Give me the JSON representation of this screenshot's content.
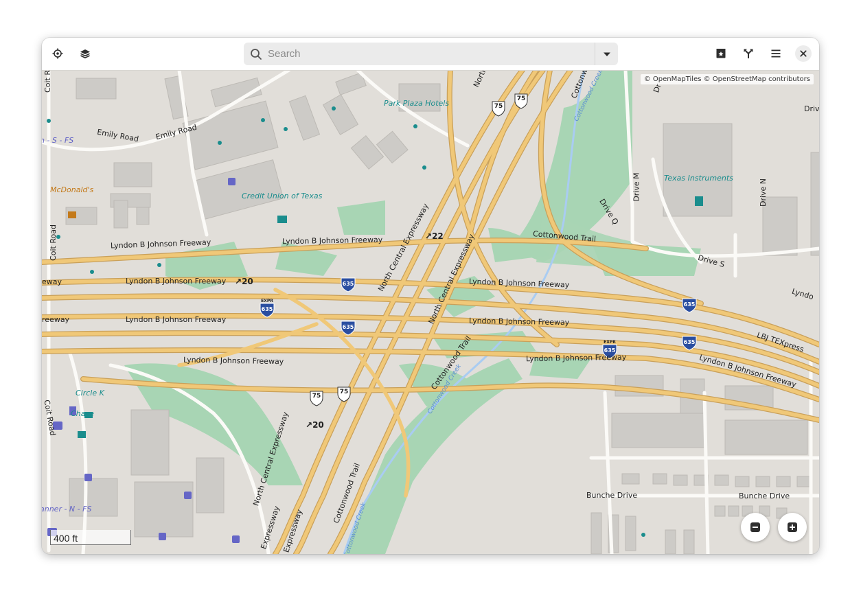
{
  "header": {
    "search_placeholder": "Search",
    "search_value": ""
  },
  "map": {
    "attribution": "© OpenMapTiles © OpenStreetMap contributors",
    "scale_label": "400 ft",
    "labels": {
      "emily_road_1": "Emily Road",
      "emily_road_2": "Emily Road",
      "coit_road_1": "Coit Road",
      "coit_road_2": "Coit Road",
      "coit_road_3": "Coit R",
      "bus_s": "n - S - FS",
      "bus_n": "anner - N - FS",
      "mcdonalds": "McDonald's",
      "credit_union": "Credit Union of Texas",
      "park_plaza": "Park Plaza Hotels",
      "texas_instruments": "Texas Instruments",
      "circle_k": "Circle K",
      "chase": "Chase",
      "lbj_1": "Lyndon B Johnson Freeway",
      "lbj_2": "Lyndon B Johnson Freeway",
      "lbj_3": "Lyndon B Johnson Freeway",
      "lbj_4": "Lyndon B Johnson Freeway",
      "lbj_5": "Lyndon B Johnson Freeway",
      "lbj_6": "Lyndon B Johnson Freeway",
      "lbj_7": "Lyndon B Johnson Freeway",
      "lbj_8": "Lyndon B Johnson Freeway",
      "lbj_9": "Lyndon B Johnson Freeway",
      "lbj_10": "Lyndon B Johnson Freeway",
      "lbj_edge_1": "eway",
      "lbj_edge_2": "reeway",
      "lbj_edge_3": "Lyndo",
      "lbj_texpress": "LBJ TEXpress",
      "nce_1": "North Central Expressway",
      "nce_2": "North Central Expressway",
      "nce_3": "North Central Expressway",
      "nce_4": "Expressway",
      "nce_5": "Expressway",
      "nce_6": "North",
      "cottonwood_trail_1": "Cottonwood Trail",
      "cottonwood_trail_2": "Cottonwood Trail",
      "cottonwood_trail_3": "Cottonwood Trail",
      "cottonwood_trail_4": "Cottonwo",
      "cottonwood_creek_1": "Cottonwood Creek",
      "cottonwood_creek_2": "Cottonwood Creek",
      "cottonwood_creek_3": "Cottonwood Creek",
      "drive_m": "Drive M",
      "drive_n": "Drive N",
      "drive_q": "Drive Q",
      "drive_s": "Drive S",
      "drive_top": "Driv",
      "drive_top2": "Dr",
      "bunche_1": "Bunche Drive",
      "bunche_2": "Bunche Drive",
      "exit_22": "22",
      "exit_20a": "20",
      "exit_20b": "20",
      "shield_635": "635",
      "shield_75": "75",
      "shield_expr": "EXPR"
    }
  },
  "colors": {
    "land": "#e1ded9",
    "green": "#a8d5b4",
    "motorway": "#f0c878",
    "motorway_casing": "#c9a05a",
    "water": "#a9ccf2",
    "building": "#cdcbc7",
    "poi_teal": "#1a8d8d",
    "bus_blue": "#6566c6"
  },
  "icons": [
    "locate-icon",
    "layers-icon",
    "search-icon",
    "dropdown-icon",
    "favorites-icon",
    "route-icon",
    "menu-icon",
    "close-icon",
    "zoom-out-icon",
    "zoom-in-icon"
  ]
}
